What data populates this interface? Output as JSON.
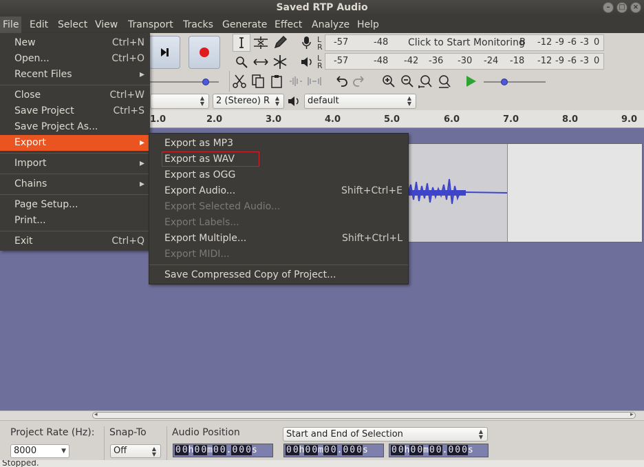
{
  "window": {
    "title": "Saved RTP Audio"
  },
  "menubar": {
    "items": [
      "File",
      "Edit",
      "Select",
      "View",
      "Transport",
      "Tracks",
      "Generate",
      "Effect",
      "Analyze",
      "Help"
    ]
  },
  "file_menu": {
    "items": [
      {
        "label": "New",
        "shortcut": "Ctrl+N"
      },
      {
        "label": "Open...",
        "shortcut": "Ctrl+O"
      },
      {
        "label": "Recent Files",
        "shortcut": "▸"
      },
      {
        "label": "Close",
        "shortcut": "Ctrl+W"
      },
      {
        "label": "Save Project",
        "shortcut": "Ctrl+S"
      },
      {
        "label": "Save Project As...",
        "shortcut": ""
      },
      {
        "label": "Export",
        "shortcut": "▸"
      },
      {
        "label": "Import",
        "shortcut": "▸"
      },
      {
        "label": "Chains",
        "shortcut": "▸"
      },
      {
        "label": "Page Setup...",
        "shortcut": ""
      },
      {
        "label": "Print...",
        "shortcut": ""
      },
      {
        "label": "Exit",
        "shortcut": "Ctrl+Q"
      }
    ]
  },
  "export_menu": {
    "items": [
      {
        "label": "Export as MP3",
        "shortcut": ""
      },
      {
        "label": "Export as WAV",
        "shortcut": ""
      },
      {
        "label": "Export as OGG",
        "shortcut": ""
      },
      {
        "label": "Export Audio...",
        "shortcut": "Shift+Ctrl+E"
      },
      {
        "label": "Export Selected Audio...",
        "shortcut": ""
      },
      {
        "label": "Export Labels...",
        "shortcut": ""
      },
      {
        "label": "Export Multiple...",
        "shortcut": "Shift+Ctrl+L"
      },
      {
        "label": "Export MIDI...",
        "shortcut": ""
      },
      {
        "label": "Save Compressed Copy of Project...",
        "shortcut": ""
      }
    ]
  },
  "meters": {
    "record": {
      "lr": "L\nR",
      "scale_a": "-57",
      "scale_b": "-48",
      "prompt": "Click to Start Monitoring",
      "tail": "B",
      "scale_c": "-12",
      "scale_d": "-9",
      "scale_e": "-6",
      "scale_f": "-3",
      "scale_g": "0"
    },
    "play": {
      "lr": "L\nR",
      "scale": [
        "-57",
        "-48",
        "-42",
        "-36",
        "-30",
        "-24",
        "-18",
        "-12",
        "-9",
        "-6",
        "-3",
        "0"
      ]
    }
  },
  "device": {
    "channels": "2 (Stereo) R",
    "output": "default"
  },
  "ruler": {
    "ticks": [
      "1.0",
      "2.0",
      "3.0",
      "4.0",
      "5.0",
      "6.0",
      "7.0",
      "8.0",
      "9.0"
    ]
  },
  "bottom": {
    "project_rate_label": "Project Rate (Hz):",
    "project_rate_value": "8000",
    "snap_label": "Snap-To",
    "snap_value": "Off",
    "audio_position_label": "Audio Position",
    "selection_mode": "Start and End of Selection",
    "time_value": "00h00m00.000s"
  },
  "status": {
    "text": "Stopped."
  },
  "colors": {
    "menu_bg": "#3c3b37",
    "highlight": "#e95420",
    "waveform": "#3f45c8",
    "track_bg": "#6e6f9a"
  }
}
